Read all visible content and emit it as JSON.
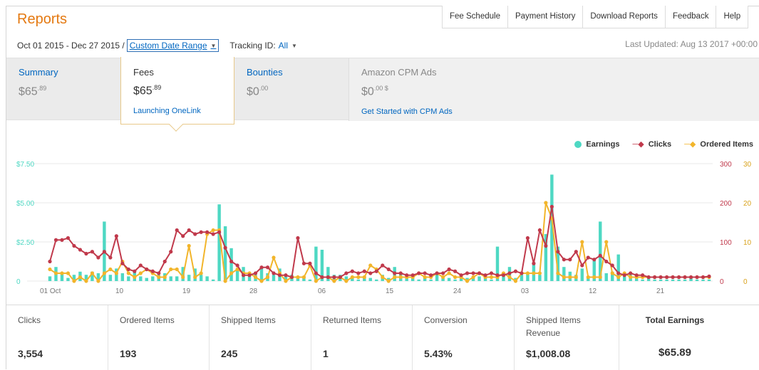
{
  "header": {
    "title": "Reports",
    "nav": [
      "Fee Schedule",
      "Payment History",
      "Download Reports",
      "Feedback",
      "Help"
    ]
  },
  "filters": {
    "date_text": "Oct 01 2015 - Dec 27 2015 /",
    "date_select": "Custom Date Range",
    "tracking_label": "Tracking ID:",
    "tracking_value": "All",
    "last_updated": "Last Updated: Aug 13 2017 +00:00"
  },
  "tabs": {
    "summary": {
      "title": "Summary",
      "amount_main": "$65",
      "amount_cents": ".89"
    },
    "fees": {
      "title": "Fees",
      "amount_main": "$65",
      "amount_cents": ".89",
      "link": "Launching OneLink"
    },
    "bounties": {
      "title": "Bounties",
      "amount_main": "$0",
      "amount_cents": ".00"
    },
    "cpm": {
      "title": "Amazon CPM Ads",
      "amount_main": "$0",
      "amount_cents": ".00 $",
      "link": "Get Started with CPM Ads"
    }
  },
  "colors": {
    "earnings": "#4ed8c3",
    "clicks": "#c0394b",
    "ordered": "#f2b52b",
    "accent": "#e47911",
    "link": "#0066c0"
  },
  "chart_data": {
    "type": "bar+line",
    "legend": [
      {
        "name": "Earnings",
        "color": "#4ed8c3"
      },
      {
        "name": "Clicks",
        "color": "#c0394b"
      },
      {
        "name": "Ordered Items",
        "color": "#f2b52b"
      }
    ],
    "x_ticks": [
      "01 Oct",
      "10",
      "19",
      "28",
      "06",
      "15",
      "24",
      "03",
      "12",
      "21"
    ],
    "y_left_ticks": [
      "$7.50",
      "$5.00",
      "$2.50",
      "0"
    ],
    "y_mid_ticks": [
      "300",
      "200",
      "100",
      "0"
    ],
    "y_right_ticks": [
      "30",
      "20",
      "10",
      "0"
    ],
    "ylim_left": [
      0,
      7.5
    ],
    "ylim_clicks": [
      0,
      300
    ],
    "ylim_ordered": [
      0,
      30
    ],
    "earnings": [
      0.3,
      0.9,
      0.5,
      0.2,
      0.4,
      0.6,
      0.4,
      0.6,
      0.5,
      3.8,
      0.4,
      0.8,
      0.5,
      0.3,
      0.6,
      0.3,
      0.2,
      0.3,
      0.4,
      0.5,
      0.3,
      0.3,
      0.9,
      0.4,
      0.8,
      0.4,
      0.3,
      0.1,
      4.9,
      3.5,
      2.1,
      0.8,
      0.9,
      0.3,
      0.4,
      0.9,
      0.5,
      0.4,
      0.8,
      0.3,
      0.4,
      0.2,
      0.2,
      0.1,
      2.2,
      2.0,
      0.9,
      0.4,
      0.4,
      0.3,
      0.2,
      0.1,
      0.3,
      0.2,
      0.1,
      0.4,
      0.2,
      0.9,
      0.5,
      0.3,
      0.2,
      0.1,
      0.2,
      0.1,
      0.4,
      0.2,
      0.2,
      0.1,
      0.2,
      0.2,
      0.2,
      0.3,
      0.2,
      0.1,
      2.2,
      0.3,
      0.9,
      0.2,
      0.4,
      0.5,
      1.2,
      0.4,
      3.0,
      6.8,
      2.2,
      0.9,
      0.6,
      0.4,
      0.8,
      0.3,
      1.4,
      3.8,
      0.5,
      0.6,
      1.7,
      0.3,
      0.4,
      0.2,
      0.1,
      0.2,
      0.1,
      0.1,
      0.1,
      0.1,
      0.1,
      0.1,
      0.2,
      0.1,
      0.1,
      0.1
    ],
    "clicks": [
      50,
      105,
      105,
      110,
      90,
      80,
      70,
      75,
      60,
      75,
      60,
      115,
      45,
      30,
      25,
      40,
      30,
      25,
      20,
      50,
      75,
      130,
      115,
      130,
      120,
      125,
      125,
      120,
      125,
      85,
      50,
      40,
      15,
      15,
      20,
      35,
      35,
      20,
      15,
      15,
      10,
      110,
      45,
      45,
      20,
      10,
      10,
      10,
      10,
      20,
      25,
      20,
      25,
      20,
      25,
      40,
      30,
      20,
      20,
      15,
      15,
      20,
      20,
      15,
      20,
      20,
      30,
      25,
      15,
      20,
      20,
      20,
      15,
      20,
      15,
      15,
      20,
      25,
      20,
      110,
      45,
      130,
      90,
      190,
      75,
      55,
      55,
      75,
      40,
      60,
      55,
      65,
      50,
      40,
      20,
      15,
      20,
      15,
      15,
      10,
      10,
      10,
      10,
      10,
      10,
      10,
      10,
      10,
      10,
      12
    ],
    "ordered": [
      3,
      2,
      2,
      2,
      0,
      1,
      0,
      2,
      0,
      2,
      3,
      2,
      5,
      2,
      1,
      2,
      3,
      2,
      1,
      1,
      3,
      3,
      1,
      9,
      1,
      2,
      12,
      13,
      13,
      0,
      2,
      3,
      2,
      2,
      1,
      0,
      1,
      6,
      2,
      0,
      1,
      1,
      1,
      4,
      0,
      1,
      1,
      0,
      1,
      0,
      1,
      1,
      1,
      4,
      3,
      1,
      0,
      1,
      1,
      1,
      1,
      2,
      1,
      1,
      2,
      1,
      2,
      1,
      1,
      0,
      1,
      2,
      1,
      1,
      1,
      2,
      1,
      0,
      2,
      2,
      2,
      2,
      20,
      16,
      2,
      1,
      1,
      1,
      10,
      1,
      1,
      1,
      10,
      2,
      1,
      2,
      1,
      1,
      1,
      1,
      1,
      1,
      1,
      1,
      1,
      1,
      1,
      1,
      1,
      1
    ]
  },
  "metrics": [
    {
      "label": "Clicks",
      "value": "3,554"
    },
    {
      "label": "Ordered Items",
      "value": "193"
    },
    {
      "label": "Shipped Items",
      "value": "245"
    },
    {
      "label": "Returned Items",
      "value": "1"
    },
    {
      "label": "Conversion",
      "value": "5.43%"
    },
    {
      "label": "Shipped Items Revenue",
      "value": "$1,008.08"
    },
    {
      "label": "Total Earnings",
      "value": "$65.89"
    }
  ]
}
